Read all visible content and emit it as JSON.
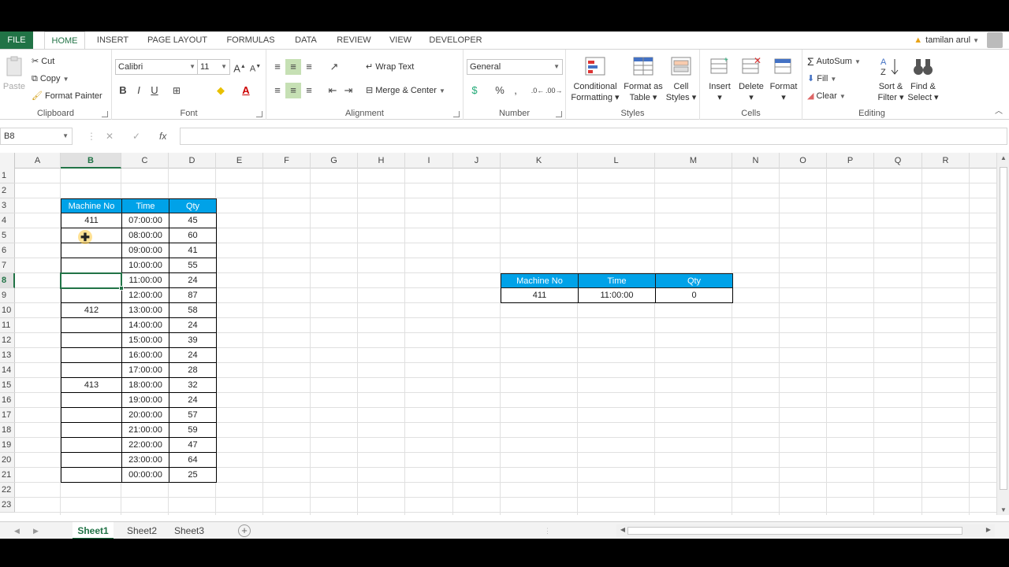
{
  "ribbon_tabs": [
    {
      "label": "FILE"
    },
    {
      "label": "HOME"
    },
    {
      "label": "INSERT"
    },
    {
      "label": "PAGE LAYOUT"
    },
    {
      "label": "FORMULAS"
    },
    {
      "label": "DATA"
    },
    {
      "label": "REVIEW"
    },
    {
      "label": "VIEW"
    },
    {
      "label": "DEVELOPER"
    }
  ],
  "user": {
    "name": "tamilan arul"
  },
  "clipboard": {
    "label": "Clipboard",
    "paste": "Paste",
    "cut": "Cut",
    "copy": "Copy",
    "format_painter": "Format Painter"
  },
  "font": {
    "label": "Font",
    "family": "Calibri",
    "size": "11",
    "bold": "B",
    "italic": "I",
    "underline": "U"
  },
  "alignment": {
    "label": "Alignment",
    "wrap": "Wrap Text",
    "merge": "Merge & Center"
  },
  "number": {
    "label": "Number",
    "format": "General",
    "percent": "%"
  },
  "styles": {
    "label": "Styles",
    "conditional_1": "Conditional",
    "conditional_2": "Formatting",
    "format_table_1": "Format as",
    "format_table_2": "Table",
    "cell_styles_1": "Cell",
    "cell_styles_2": "Styles"
  },
  "cells_group": {
    "label": "Cells",
    "insert": "Insert",
    "delete": "Delete",
    "format": "Format"
  },
  "editing": {
    "label": "Editing",
    "autosum": "AutoSum",
    "fill": "Fill",
    "clear": "Clear",
    "sort_1": "Sort &",
    "sort_2": "Filter",
    "find_1": "Find &",
    "find_2": "Select"
  },
  "formula_bar": {
    "name_box": "B8",
    "fx": "fx",
    "value": ""
  },
  "columns": [
    "A",
    "B",
    "C",
    "D",
    "E",
    "F",
    "G",
    "H",
    "I",
    "J",
    "K",
    "L",
    "M",
    "N",
    "O",
    "P",
    "Q",
    "R"
  ],
  "rows": [
    "1",
    "2",
    "3",
    "4",
    "5",
    "6",
    "7",
    "8",
    "9",
    "10",
    "11",
    "12",
    "13",
    "14",
    "15",
    "16",
    "17",
    "18",
    "19",
    "20",
    "21",
    "22",
    "23"
  ],
  "selected": {
    "column": "B",
    "row": "8"
  },
  "table1": {
    "headers": [
      "Machine No",
      "Time",
      "Qty"
    ],
    "rows": [
      {
        "machine": "411",
        "time": "07:00:00",
        "qty": "45"
      },
      {
        "machine": "",
        "time": "08:00:00",
        "qty": "60"
      },
      {
        "machine": "",
        "time": "09:00:00",
        "qty": "41"
      },
      {
        "machine": "",
        "time": "10:00:00",
        "qty": "55"
      },
      {
        "machine": "",
        "time": "11:00:00",
        "qty": "24"
      },
      {
        "machine": "",
        "time": "12:00:00",
        "qty": "87"
      },
      {
        "machine": "412",
        "time": "13:00:00",
        "qty": "58"
      },
      {
        "machine": "",
        "time": "14:00:00",
        "qty": "24"
      },
      {
        "machine": "",
        "time": "15:00:00",
        "qty": "39"
      },
      {
        "machine": "",
        "time": "16:00:00",
        "qty": "24"
      },
      {
        "machine": "",
        "time": "17:00:00",
        "qty": "28"
      },
      {
        "machine": "413",
        "time": "18:00:00",
        "qty": "32"
      },
      {
        "machine": "",
        "time": "19:00:00",
        "qty": "24"
      },
      {
        "machine": "",
        "time": "20:00:00",
        "qty": "57"
      },
      {
        "machine": "",
        "time": "21:00:00",
        "qty": "59"
      },
      {
        "machine": "",
        "time": "22:00:00",
        "qty": "47"
      },
      {
        "machine": "",
        "time": "23:00:00",
        "qty": "64"
      },
      {
        "machine": "",
        "time": "00:00:00",
        "qty": "25"
      }
    ]
  },
  "table2": {
    "headers": [
      "Machine No",
      "Time",
      "Qty"
    ],
    "rows": [
      {
        "machine": "411",
        "time": "11:00:00",
        "qty": "0"
      }
    ]
  },
  "sheets": [
    {
      "label": "Sheet1"
    },
    {
      "label": "Sheet2"
    },
    {
      "label": "Sheet3"
    }
  ],
  "colors": {
    "excel_green": "#217346",
    "header_fill": "#00a2e8"
  }
}
